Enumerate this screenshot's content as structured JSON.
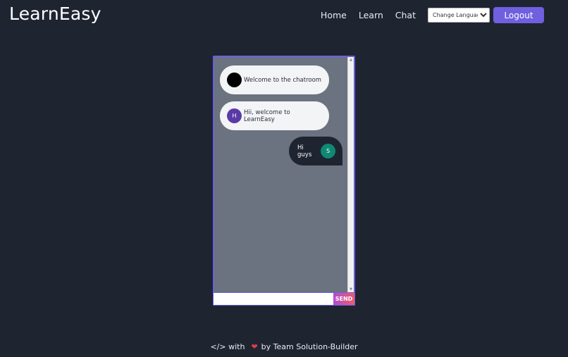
{
  "header": {
    "brand": "LearnEasy",
    "nav": [
      {
        "label": "Home"
      },
      {
        "label": "Learn"
      },
      {
        "label": "Chat"
      }
    ],
    "language_select": {
      "selected": "Change Language"
    },
    "logout_label": "Logout"
  },
  "chat": {
    "messages": [
      {
        "sender_initial": "",
        "text": "Welcome to the chatroom",
        "direction": "incoming",
        "avatar_color": "#000000"
      },
      {
        "sender_initial": "H",
        "text": "Hii, welcome to LearnEasy",
        "direction": "incoming",
        "avatar_color": "#5b3aa8"
      },
      {
        "sender_initial": "S",
        "text": "Hi guys",
        "direction": "outgoing",
        "avatar_color": "#0e8a74"
      }
    ],
    "input": {
      "value": "",
      "placeholder": ""
    },
    "send_label": "SEND"
  },
  "footer": {
    "prefix": "</> with",
    "heart_icon": "heart-icon",
    "suffix": "by Team Solution-Builder"
  },
  "colors": {
    "background": "#1f2431",
    "accent": "#7060e0",
    "chat_panel": "#6b7280",
    "heart": "#e03b4b"
  }
}
